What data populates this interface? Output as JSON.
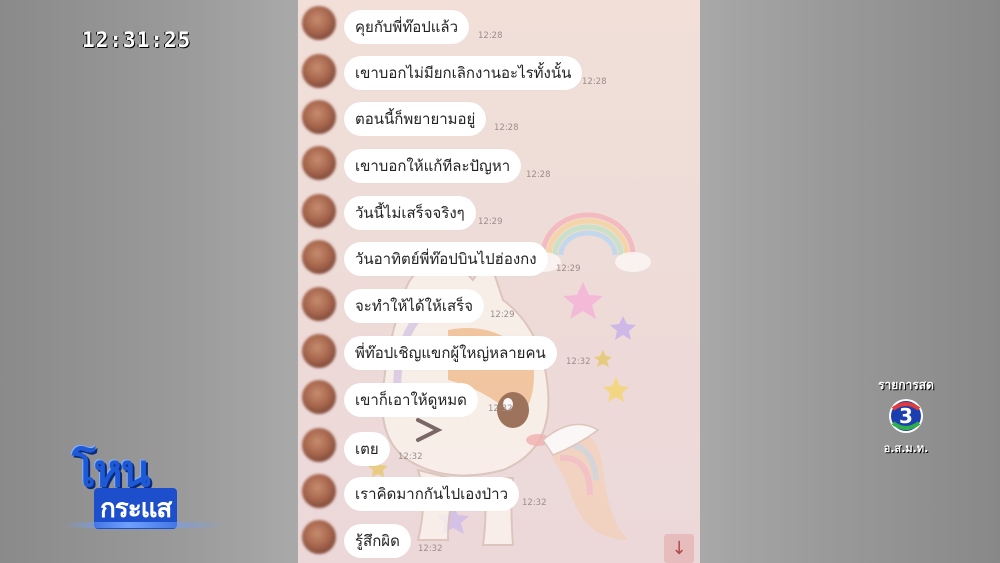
{
  "broadcast": {
    "clock": "12:31:25",
    "channel_top": "รายการสด",
    "channel_number": "3",
    "channel_bottom": "อ.ส.ม.ท.",
    "show_title_line1": "โหน",
    "show_title_line2": "กระแส"
  },
  "colors": {
    "chat_background": "#eedcd8",
    "bubble": "#ffffff",
    "scroll_button": "#e6bcbc",
    "show_logo_blue": "#1e5ad6"
  },
  "chat": {
    "messages": [
      {
        "text": "คุยกับพี่ท๊อปแล้ว",
        "time": "12:28"
      },
      {
        "text": "เขาบอกไม่มียกเลิกงานอะไรทั้งนั้น",
        "time": "12:28"
      },
      {
        "text": "ตอนนี้ก็พยายามอยู่",
        "time": "12:28"
      },
      {
        "text": "เขาบอกให้แก้ทีละปัญหา",
        "time": "12:28"
      },
      {
        "text": "วันนี้ไม่เสร็จจริงๆ",
        "time": "12:29"
      },
      {
        "text": "วันอาทิตย์พี่ท๊อปบินไปฮ่องกง",
        "time": "12:29"
      },
      {
        "text": "จะทำให้ได้ให้เสร็จ",
        "time": "12:29"
      },
      {
        "text": "พี่ท๊อปเชิญแขกผู้ใหญ่หลายคน",
        "time": "12:32"
      },
      {
        "text": "เขาก็เอาให้ดูหมด",
        "time": "12:32"
      },
      {
        "text": "เตย",
        "time": "12:32"
      },
      {
        "text": "เราคิดมากกันไปเองป่าว",
        "time": "12:32"
      },
      {
        "text": "รู้สึกผิด",
        "time": "12:32"
      }
    ],
    "scroll_button_icon": "arrow-down-icon"
  }
}
